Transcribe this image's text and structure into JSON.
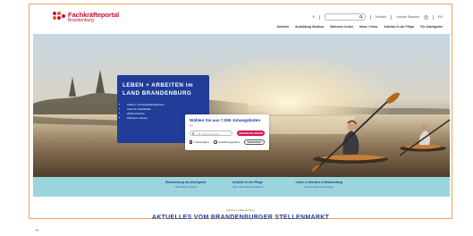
{
  "brand": {
    "title": "Fachkräfteportal",
    "subtitle": "Brandenburg",
    "red": "#c8102e"
  },
  "utility": {
    "font_size": "A",
    "search_icon": "search-icon",
    "items": [
      "Kontakt",
      "Leichte Sprache",
      "EN"
    ]
  },
  "nav": {
    "items": [
      "Arbeiten",
      "Ausbildung Studium",
      "Welcome Center",
      "News + Infos",
      "Arbeiten in der Pflege",
      "Für Arbeitgeber"
    ]
  },
  "hero": {
    "card": {
      "headline_line1": "LEBEN + ARBEITEN im",
      "headline_line2": "LAND BRANDENBURG",
      "bullets": [
        "Stellen- und Ausbildungsbörse",
        "Infos für Fachkräfte",
        "Wohnortsuche",
        "Welcome Center"
      ],
      "color": "#1f3d99"
    },
    "search": {
      "title": "Wählen Sie aus 7.095 Jobangeboten ...",
      "input_placeholder": "z. B. Wohnortsuche",
      "primary_button": "ANGEBOTE ZEIGEN",
      "secondary_button": "ERWEITERT",
      "checkbox_label": "Arbeitsplätze",
      "radio_label": "Ausbildungsplätze",
      "accent": "#d4145a"
    }
  },
  "teal_band": {
    "color": "#9ad5dc",
    "items": [
      {
        "title": "Brandenburg als Arbeitgeber",
        "sub": "Öffentlicher Dienst"
      },
      {
        "title": "Arbeiten in der Pflege",
        "sub": "Über 700 Stellenangebote"
      },
      {
        "title": "Leben & Arbeiten in Brandenburg",
        "sub": "auch für Berufseinsteiger"
      }
    ]
  },
  "section": {
    "kicker": "Karriere in Brandenburg",
    "headline": "AKTUELLES VOM BRANDENBURGER STELLENMARKT"
  }
}
